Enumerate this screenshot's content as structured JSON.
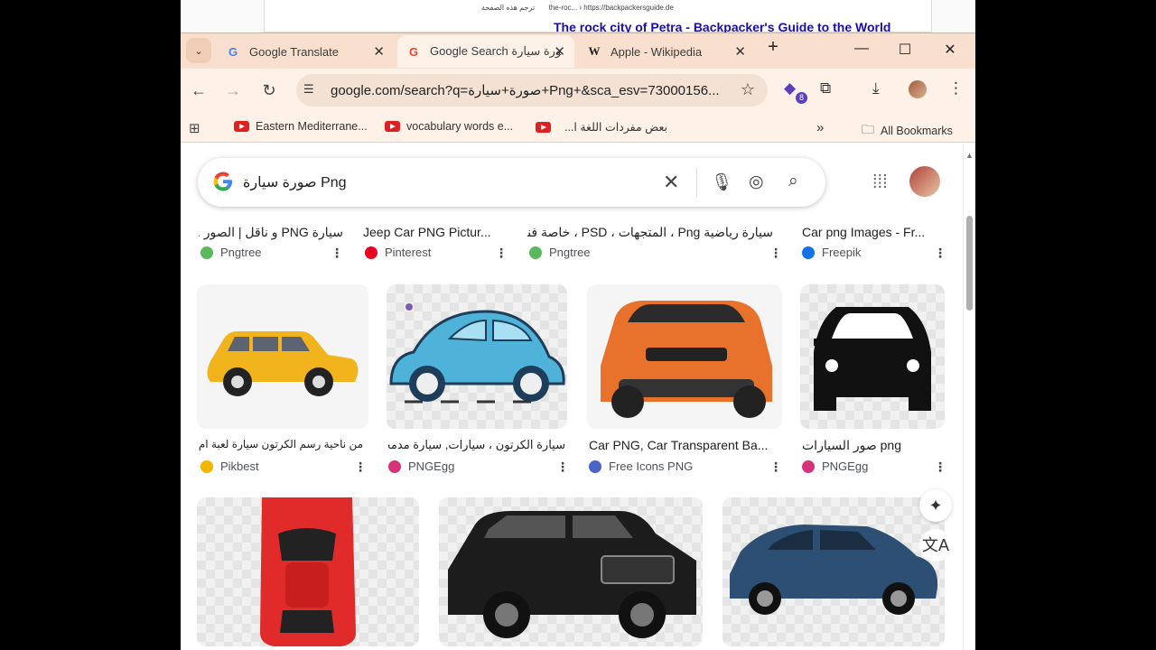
{
  "background_window": {
    "line1": "the-roc... › https://backpackersguide.de",
    "line1_ar": "ترجم هذه الصفحة",
    "line2": "The rock city of Petra - Backpacker's Guide to the World"
  },
  "tabs": [
    {
      "label": "Google Translate",
      "icon": "google-translate-icon"
    },
    {
      "label": "Google Search صورة سيارة",
      "icon": "google-g-icon"
    },
    {
      "label": "Apple - Wikipedia",
      "icon": "wikipedia-w-icon"
    }
  ],
  "toolbar": {
    "url": "google.com/search?q=صورة+سيارة+Png+&sca_esv=73000156...",
    "extension_badge": "8"
  },
  "bookmarks": [
    "Eastern Mediterrane...",
    "vocabulary words e...",
    "بعض مفردات اللغة ا...",
    "All Bookmarks"
  ],
  "search": {
    "query": "صورة سيارة Png"
  },
  "results_top": [
    {
      "caption": "سيارة PNG و ناقل | الصور ...",
      "source": "Pngtree",
      "color": "#5cb85c"
    },
    {
      "caption": "Jeep Car PNG Pictur...",
      "source": "Pinterest",
      "color": "#e60023"
    },
    {
      "caption": "سيارة رياضية Png ، المتجهات ، PSD ، خاصة فنية ...",
      "source": "Pngtree",
      "color": "#5cb85c"
    },
    {
      "caption": "Car png Images - Fr...",
      "source": "Freepik",
      "color": "#1273eb"
    }
  ],
  "results_mid": [
    {
      "caption": "من ناحية رسم الكرتون سيارة لعبة ام...",
      "source": "Pikbest",
      "color": "#f5b400"
    },
    {
      "caption": "سيارة الكرتون ، سيارات, سيارة مدمجة...",
      "source": "PNGEgg",
      "color": "#d6337a"
    },
    {
      "caption": "Car PNG, Car Transparent Ba...",
      "source": "Free Icons PNG",
      "color": "#4a64c8"
    },
    {
      "caption": "صور السيارات png",
      "source": "PNGEgg",
      "color": "#d6337a"
    }
  ]
}
